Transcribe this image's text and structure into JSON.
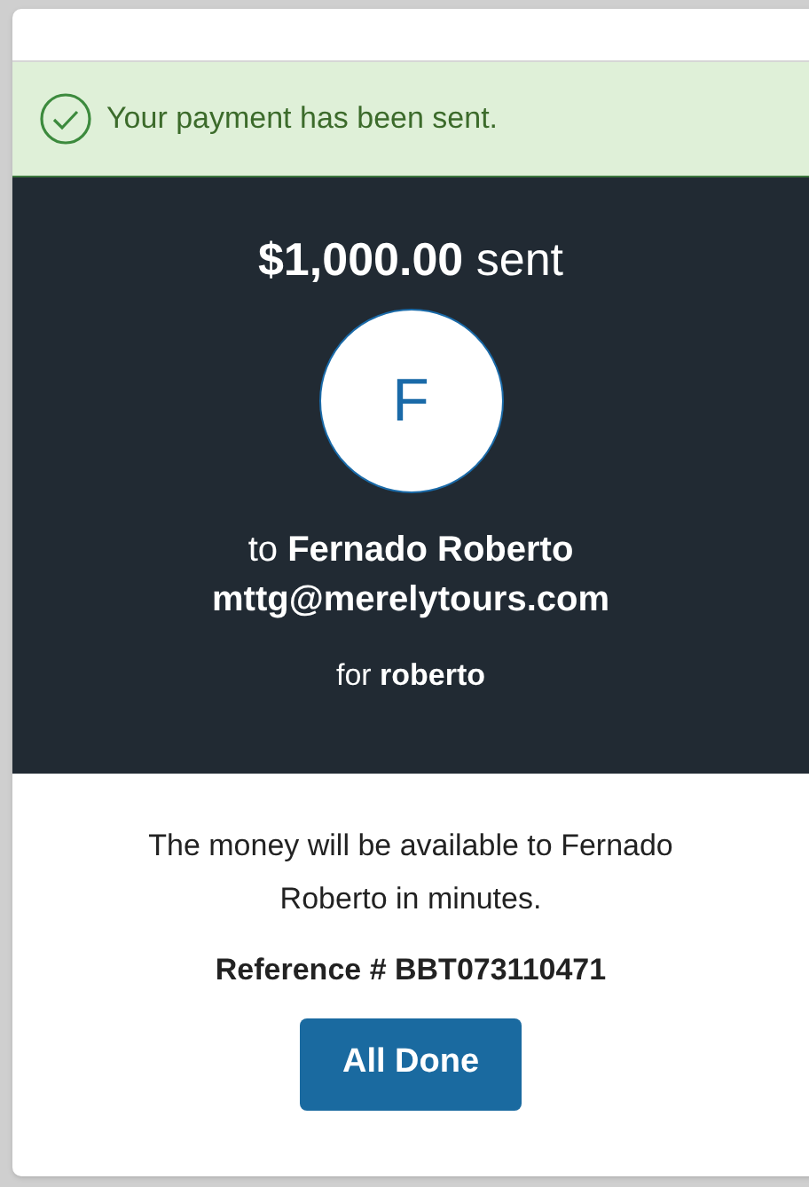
{
  "alert": {
    "message": "Your payment has been sent."
  },
  "summary": {
    "amount": "$1,000.00",
    "amount_suffix": "sent",
    "avatar_initial": "F",
    "recipient": "to **Fernado Roberto**",
    "email": "mttg@merelytours.com",
    "note": "for **roberto**"
  },
  "details": {
    "message": "The money will be available to Fernado Roberto in minutes.",
    "reference": "Reference # BBT073110471"
  },
  "buttons": [
    "All Done"
  ]
}
